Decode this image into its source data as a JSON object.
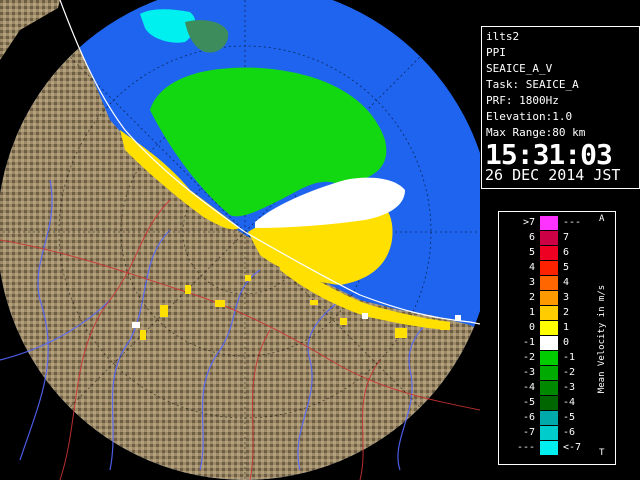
{
  "header": {
    "site": "ilts2",
    "product": "PPI",
    "product_name": "SEAICE_A_V",
    "task": "Task: SEAICE_A",
    "prf": "PRF: 1800Hz",
    "elevation": "Elevation:1.0",
    "max_range": "Max Range:80 km",
    "time": "15:31:03",
    "date": "26 DEC 2014 JST"
  },
  "legend": {
    "unit_label": "Mean Velocity in m/s",
    "corner_top": "A",
    "corner_bottom": "T",
    "rows": [
      {
        "left": ">7",
        "right": "---",
        "color": "#ff33ff"
      },
      {
        "left": "6",
        "right": "7",
        "color": "#cc0044"
      },
      {
        "left": "5",
        "right": "6",
        "color": "#ee0022"
      },
      {
        "left": "4",
        "right": "5",
        "color": "#ff2200"
      },
      {
        "left": "3",
        "right": "4",
        "color": "#ff6600"
      },
      {
        "left": "2",
        "right": "3",
        "color": "#ff9900"
      },
      {
        "left": "1",
        "right": "2",
        "color": "#ffcc00"
      },
      {
        "left": "0",
        "right": "1",
        "color": "#ffff00"
      },
      {
        "left": "-1",
        "right": "0",
        "color": "#ffffff"
      },
      {
        "left": "-2",
        "right": "-1",
        "color": "#00cc00"
      },
      {
        "left": "-3",
        "right": "-2",
        "color": "#00aa00"
      },
      {
        "left": "-4",
        "right": "-3",
        "color": "#008800"
      },
      {
        "left": "-5",
        "right": "-4",
        "color": "#006600"
      },
      {
        "left": "-6",
        "right": "-5",
        "color": "#00aaaa"
      },
      {
        "left": "-7",
        "right": "-6",
        "color": "#00cccc"
      },
      {
        "left": "---",
        "right": "<-7",
        "color": "#00eeee"
      }
    ]
  },
  "colors": {
    "sea": "#1e64ee",
    "land": "#9c8a68",
    "echo_green": "#12d812",
    "echo_yellow": "#ffe000",
    "echo_white": "#ffffff",
    "echo_cyan": "#00f0f0",
    "river": "#5566ff",
    "boundary": "#cc3333"
  }
}
